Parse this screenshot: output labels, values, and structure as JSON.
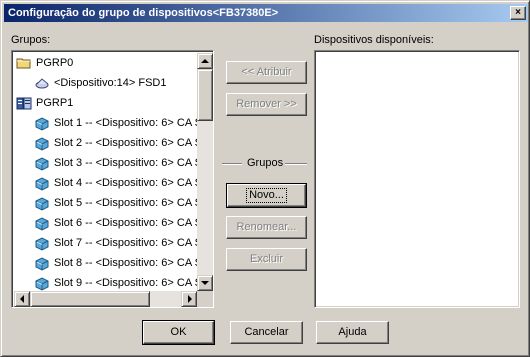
{
  "window": {
    "title": "Configuração do grupo de dispositivos<FB37380E>",
    "close_glyph": "×"
  },
  "left_panel": {
    "label": "Grupos:",
    "tree": [
      {
        "level": 0,
        "icon": "folder-icon",
        "label": "PGRP0"
      },
      {
        "level": 1,
        "icon": "device-icon",
        "label": "<Dispositivo:14> FSD1"
      },
      {
        "level": 0,
        "icon": "group-station-icon",
        "label": "PGRP1"
      },
      {
        "level": 1,
        "icon": "slot-module-icon",
        "label": "Slot 1 -- <Dispositivo: 6> CA S"
      },
      {
        "level": 1,
        "icon": "slot-module-icon",
        "label": "Slot 2 -- <Dispositivo: 6> CA S"
      },
      {
        "level": 1,
        "icon": "slot-module-icon",
        "label": "Slot 3 -- <Dispositivo: 6> CA S"
      },
      {
        "level": 1,
        "icon": "slot-module-icon",
        "label": "Slot 4 -- <Dispositivo: 6> CA S"
      },
      {
        "level": 1,
        "icon": "slot-module-icon",
        "label": "Slot 5 -- <Dispositivo: 6> CA S"
      },
      {
        "level": 1,
        "icon": "slot-module-icon",
        "label": "Slot 6 -- <Dispositivo: 6> CA S"
      },
      {
        "level": 1,
        "icon": "slot-module-icon",
        "label": "Slot 7 -- <Dispositivo: 6> CA S"
      },
      {
        "level": 1,
        "icon": "slot-module-icon",
        "label": "Slot 8 -- <Dispositivo: 6> CA S"
      },
      {
        "level": 1,
        "icon": "slot-module-icon",
        "label": "Slot 9 -- <Dispositivo: 6> CA S"
      }
    ]
  },
  "right_panel": {
    "label": "Dispositivos disponíveis:"
  },
  "middle": {
    "assign_label": "<< Atribuir",
    "remove_label": "Remover >>",
    "groups_heading": "Grupos",
    "new_label": "Novo...",
    "rename_label": "Renomear...",
    "delete_label": "Excluir"
  },
  "footer": {
    "ok_label": "OK",
    "cancel_label": "Cancelar",
    "help_label": "Ajuda"
  }
}
